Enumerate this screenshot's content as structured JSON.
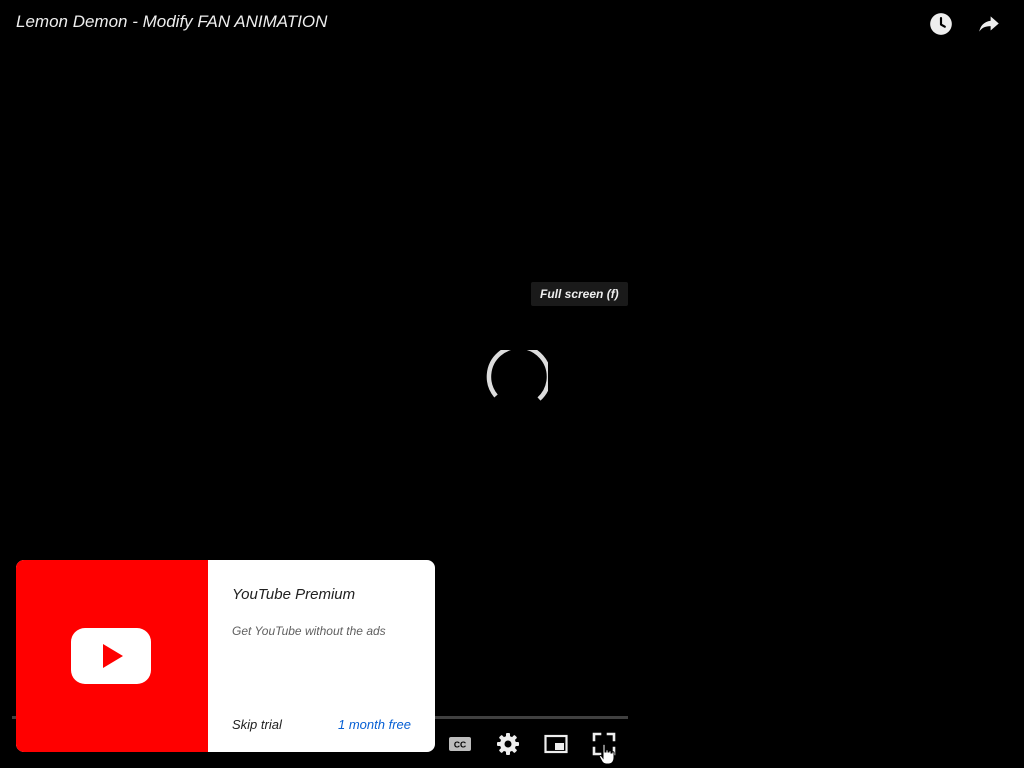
{
  "video": {
    "title": "Lemon Demon - Modify FAN ANIMATION"
  },
  "top_controls": {
    "watch_later_icon": "clock-icon",
    "share_icon": "share-arrow-icon"
  },
  "tooltip": {
    "text": "Full screen (f)"
  },
  "loading": {
    "indicator": "spinner"
  },
  "premium_promo": {
    "title": "YouTube Premium",
    "subtitle": "Get YouTube without the ads",
    "skip_label": "Skip trial",
    "offer_label": "1 month free",
    "brand_color": "#ff0000",
    "offer_color": "#065fd4"
  },
  "player_controls": {
    "captions_icon": "closed-captions-icon",
    "settings_icon": "gear-icon",
    "miniplayer_icon": "miniplayer-icon",
    "fullscreen_icon": "fullscreen-icon"
  }
}
